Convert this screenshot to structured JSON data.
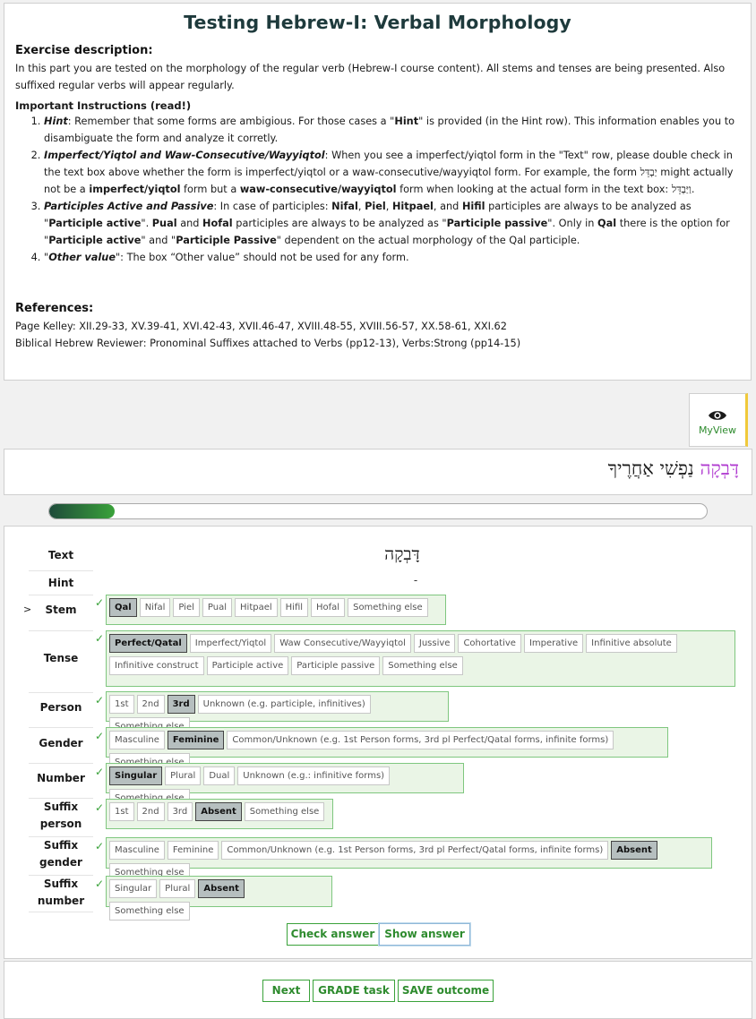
{
  "title": "Testing Hebrew-I: Verbal Morphology",
  "exercise_description": {
    "heading": "Exercise description:",
    "text": "In this part you are tested on the morphology of the regular verb (Hebrew-I course content). All stems and tenses are being presented. Also suffixed regular verbs will appear regularly."
  },
  "instructions": {
    "heading": "Important Instructions (read!)",
    "items": [
      {
        "title": "Hint",
        "text": ": Remember that some forms are ambigious. For those cases a \"",
        "b1": "Hint",
        "text2": "\" is provided (in the Hint row). This information enables you to disambiguate the form and analyze it corretly."
      },
      {
        "title": "Imperfect/Yiqtol and Waw-Consecutive/Wayyiqtol",
        "text": ": When you see a imperfect/yiqtol form in the \"Text\" row, please double check in the text box above whether the form is imperfect/yiqtol or a waw-consecutive/wayyiqtol form. For example, the form ",
        "heb1": "יַבְדֵּל",
        "text2": " might actually not be a ",
        "b1": "imperfect/yiqtol",
        "text3": " form but a ",
        "b2": "waw-consecutive/wayyiqtol",
        "text4": " form when looking at the actual form in the text box: ",
        "heb2": "וַיַּבְדֵּל",
        "text5": "."
      },
      {
        "title": "Participles Active and Passive",
        "text": ": In case of participles: ",
        "b1": "Nifal",
        "s1": ", ",
        "b2": "Piel",
        "s2": ", ",
        "b3": "Hitpael",
        "s3": ", and ",
        "b4": "Hifil",
        "s4": " participles are always to be analyzed as \"",
        "b5": "Participle active",
        "s5": "\". ",
        "b6": "Pual",
        "s6": " and ",
        "b7": "Hofal",
        "s7": " participles are always to be analyzed as \"",
        "b8": "Participle passive",
        "s8": "\". Only in ",
        "b9": "Qal",
        "s9": " there is the option for \"",
        "b10": "Participle active",
        "s10": "\" and \"",
        "b11": "Participle Passive",
        "s11": "\" dependent on the actual morphology of the Qal participle."
      },
      {
        "title": "Other value",
        "q1": "\"",
        "text": "\": The box “Other value” should not be used for any form."
      }
    ]
  },
  "references": {
    "heading": "References:",
    "line1": "Page Kelley: XII.29-33, XV.39-41, XVI.42-43, XVII.46-47, XVIII.48-55, XVIII.56-57, XX.58-61, XXI.62",
    "line2": "Biblical Hebrew Reviewer: Pronominal Suffixes attached to Verbs (pp12-13), Verbs:Strong (pp14-15)"
  },
  "myview": {
    "label": "MyView",
    "icon": "eye-icon"
  },
  "hebrew_line": {
    "word1": "דָּבְקָה",
    "rest": "נַפְשִׁי אַחֲרֶיךָ"
  },
  "progress": {
    "fraction": 0.1
  },
  "exercise": {
    "text_label": "Text",
    "text_value": "דָּבְקָה",
    "hint_label": "Hint",
    "hint_value": "-",
    "current_marker": ">",
    "check_mark": "✓",
    "rows": [
      {
        "label": "Stem",
        "options": [
          "Qal",
          "Nifal",
          "Piel",
          "Pual",
          "Hitpael",
          "Hifil",
          "Hofal",
          "Something else"
        ],
        "selected": 0
      },
      {
        "label": "Tense",
        "options": [
          "Perfect/Qatal",
          "Imperfect/Yiqtol",
          "Waw Consecutive/Wayyiqtol",
          "Jussive",
          "Cohortative",
          "Imperative",
          "Infinitive absolute",
          "Infinitive construct",
          "Participle active",
          "Participle passive",
          "Something else"
        ],
        "selected": 0
      },
      {
        "label": "Person",
        "options": [
          "1st",
          "2nd",
          "3rd",
          "Unknown (e.g. participle, infinitives)",
          "Something else"
        ],
        "selected": 2
      },
      {
        "label": "Gender",
        "options": [
          "Masculine",
          "Feminine",
          "Common/Unknown (e.g. 1st Person forms, 3rd pl Perfect/Qatal forms, infinite forms)",
          "Something else"
        ],
        "selected": 1
      },
      {
        "label": "Number",
        "options": [
          "Singular",
          "Plural",
          "Dual",
          "Unknown (e.g.: infinitive forms)",
          "Something else"
        ],
        "selected": 0
      },
      {
        "label1": "Suffix",
        "label2": "person",
        "options": [
          "1st",
          "2nd",
          "3rd",
          "Absent",
          "Something else"
        ],
        "selected": 3
      },
      {
        "label1": "Suffix",
        "label2": "gender",
        "options": [
          "Masculine",
          "Feminine",
          "Common/Unknown (e.g. 1st Person forms, 3rd pl Perfect/Qatal forms, infinite forms)",
          "Absent",
          "Something else"
        ],
        "selected": 3
      },
      {
        "label1": "Suffix",
        "label2": "number",
        "options": [
          "Singular",
          "Plural",
          "Absent",
          "Something else"
        ],
        "selected": 2
      }
    ],
    "check_answer": "Check answer",
    "show_answer": "Show answer"
  },
  "footer": {
    "next": "Next",
    "grade": "GRADE task",
    "save": "SAVE outcome"
  }
}
